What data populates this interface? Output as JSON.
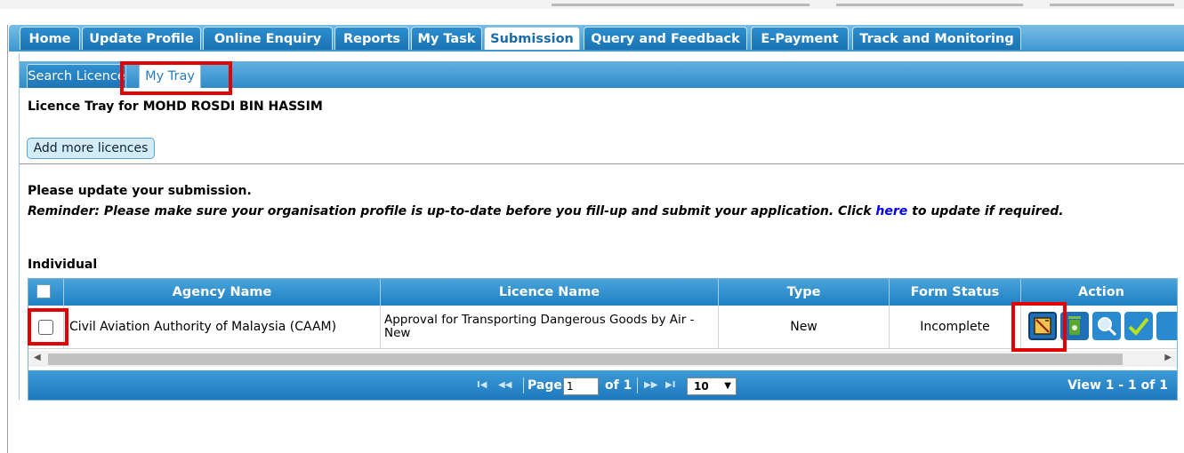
{
  "main_tabs": [
    "Home",
    "Update Profile",
    "Online Enquiry",
    "Reports",
    "My Task",
    "Submission",
    "Query and Feedback",
    "E-Payment",
    "Track and Monitoring"
  ],
  "active_main_tab": "Submission",
  "sub_tabs": [
    "Search Licence",
    "My Tray"
  ],
  "tray_title": "Licence Tray for MOHD ROSDI BIN HASSIM",
  "add_button": "Add more licences",
  "msg_update": "Please update your submission.",
  "reminder_before": "Reminder: Please make sure your organisation profile is up-to-date before you fill-up and submit your application. Click ",
  "reminder_link": "here",
  "reminder_after": " to update if required.",
  "section_label": "Individual",
  "grid": {
    "columns": [
      "Agency Name",
      "Licence Name",
      "Type",
      "Form Status",
      "Action"
    ],
    "rows": [
      {
        "agency": "Civil Aviation Authority of Malaysia (CAAM)",
        "licence": "Approval for Transporting Dangerous Goods by Air - New",
        "type": "New",
        "status": "Incomplete"
      }
    ],
    "actions": [
      "edit-icon",
      "delete-icon",
      "view-icon",
      "submit-icon"
    ]
  },
  "pager": {
    "page_label": "Page",
    "page_value": "1",
    "of_label": "of 1",
    "page_size": "10",
    "view_text": "View 1 - 1 of 1"
  },
  "colors": {
    "tab_blue": "#1a72b3",
    "header_blue": "#1f80c4",
    "highlight_red": "#e20000",
    "link": "#0000ee"
  }
}
